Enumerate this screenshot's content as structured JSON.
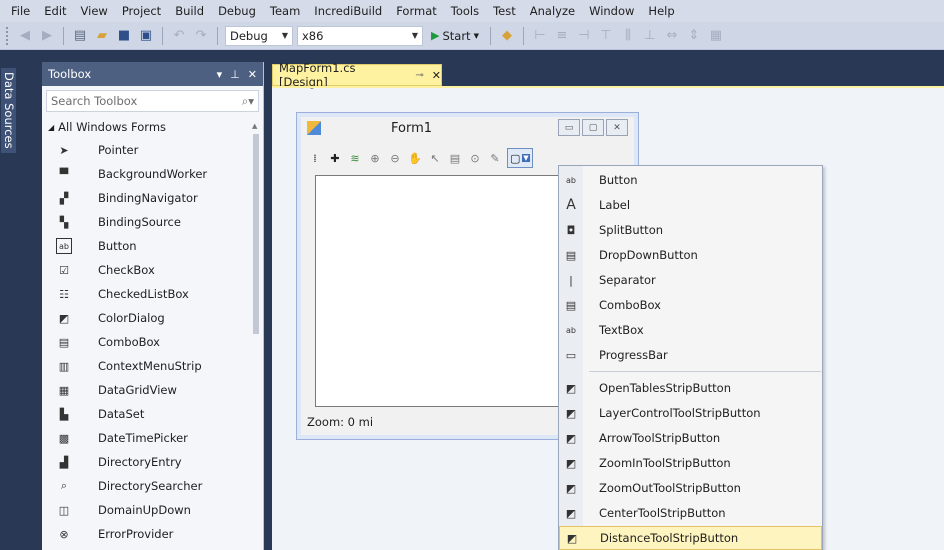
{
  "menubar": [
    "File",
    "Edit",
    "View",
    "Project",
    "Build",
    "Debug",
    "Team",
    "IncrediBuild",
    "Format",
    "Tools",
    "Test",
    "Analyze",
    "Window",
    "Help"
  ],
  "toolbar": {
    "config_value": "Debug",
    "platform_value": "x86",
    "start_label": "Start"
  },
  "vertical_tab": "Data Sources",
  "toolbox": {
    "title": "Toolbox",
    "search_placeholder": "Search Toolbox",
    "group": "All Windows Forms",
    "items": [
      {
        "label": "Pointer",
        "icon": "pointer-icon"
      },
      {
        "label": "BackgroundWorker",
        "icon": "background-worker-icon"
      },
      {
        "label": "BindingNavigator",
        "icon": "binding-navigator-icon"
      },
      {
        "label": "BindingSource",
        "icon": "binding-source-icon"
      },
      {
        "label": "Button",
        "icon": "button-icon"
      },
      {
        "label": "CheckBox",
        "icon": "checkbox-icon"
      },
      {
        "label": "CheckedListBox",
        "icon": "checked-listbox-icon"
      },
      {
        "label": "ColorDialog",
        "icon": "color-dialog-icon"
      },
      {
        "label": "ComboBox",
        "icon": "combobox-icon"
      },
      {
        "label": "ContextMenuStrip",
        "icon": "context-menu-strip-icon"
      },
      {
        "label": "DataGridView",
        "icon": "datagridview-icon"
      },
      {
        "label": "DataSet",
        "icon": "dataset-icon"
      },
      {
        "label": "DateTimePicker",
        "icon": "datetimepicker-icon"
      },
      {
        "label": "DirectoryEntry",
        "icon": "directory-entry-icon"
      },
      {
        "label": "DirectorySearcher",
        "icon": "directory-searcher-icon"
      },
      {
        "label": "DomainUpDown",
        "icon": "domain-updown-icon"
      },
      {
        "label": "ErrorProvider",
        "icon": "error-provider-icon"
      }
    ]
  },
  "document_tab": "MapForm1.cs [Design]",
  "form": {
    "title": "Form1",
    "status": "Zoom: 0 mi"
  },
  "dropdown": {
    "items": [
      {
        "label": "Button",
        "icon": "button-icon",
        "highlighted": false
      },
      {
        "label": "Label",
        "icon": "label-icon",
        "highlighted": false
      },
      {
        "label": "SplitButton",
        "icon": "split-button-icon",
        "highlighted": false
      },
      {
        "label": "DropDownButton",
        "icon": "dropdown-button-icon",
        "highlighted": false
      },
      {
        "label": "Separator",
        "icon": "separator-icon",
        "highlighted": false
      },
      {
        "label": "ComboBox",
        "icon": "combobox-icon",
        "highlighted": false
      },
      {
        "label": "TextBox",
        "icon": "textbox-icon",
        "highlighted": false
      },
      {
        "label": "ProgressBar",
        "icon": "progressbar-icon",
        "highlighted": false
      },
      {
        "label": "OpenTablesStripButton",
        "icon": "strip-button-icon",
        "highlighted": false
      },
      {
        "label": "LayerControlToolStripButton",
        "icon": "strip-button-icon",
        "highlighted": false
      },
      {
        "label": "ArrowToolStripButton",
        "icon": "strip-button-icon",
        "highlighted": false
      },
      {
        "label": "ZoomInToolStripButton",
        "icon": "strip-button-icon",
        "highlighted": false
      },
      {
        "label": "ZoomOutToolStripButton",
        "icon": "strip-button-icon",
        "highlighted": false
      },
      {
        "label": "CenterToolStripButton",
        "icon": "strip-button-icon",
        "highlighted": false
      },
      {
        "label": "DistanceToolStripButton",
        "icon": "strip-button-icon",
        "highlighted": true
      }
    ]
  },
  "colors": {
    "chrome_dark": "#293955",
    "active_tab": "#fef2a1",
    "highlight": "#fdf4bf"
  }
}
